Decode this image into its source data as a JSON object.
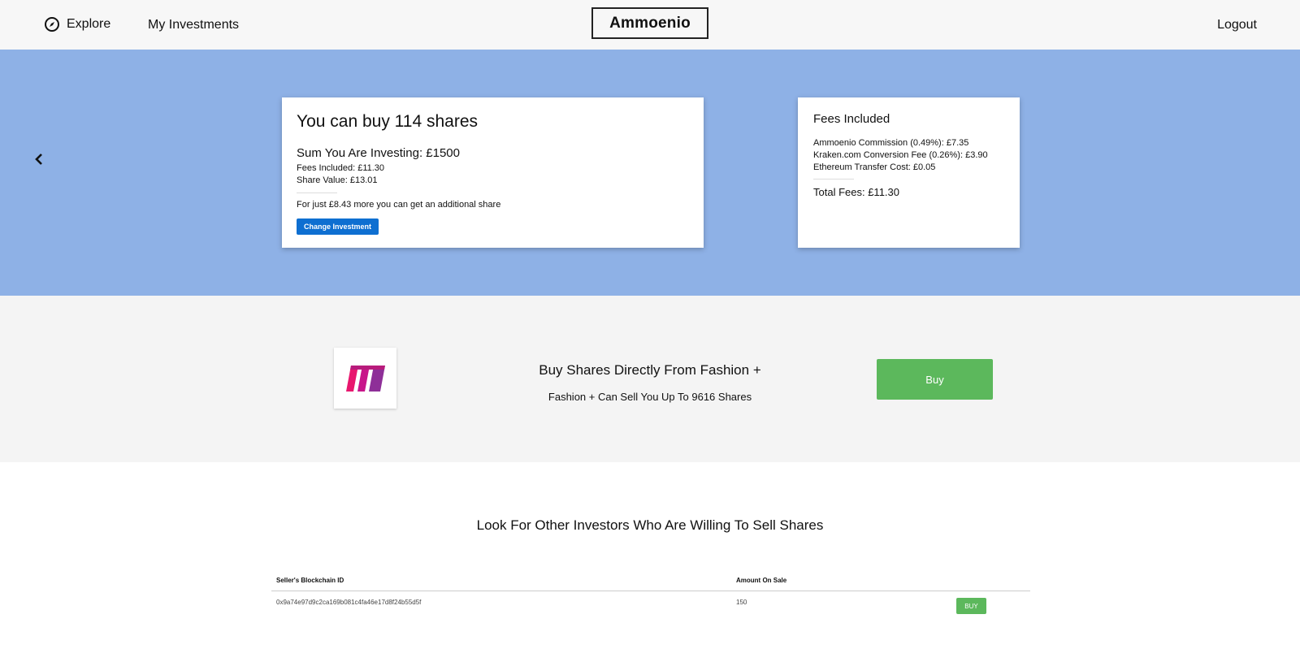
{
  "nav": {
    "explore_label": "Explore",
    "my_investments_label": "My Investments",
    "brand": "Ammoenio",
    "logout_label": "Logout"
  },
  "invest_card": {
    "headline": "You can buy 114 shares",
    "sum_investing": "Sum You Are Investing: £1500",
    "fees_included": "Fees Included: £11.30",
    "share_value": "Share Value: £13.01",
    "more_message": "For just £8.43 more you can get an additional share",
    "change_button": "Change Investment"
  },
  "fees_card": {
    "title": "Fees Included",
    "fees": [
      "Ammoenio Commission (0.49%): £7.35",
      "Kraken.com Conversion Fee (0.26%): £3.90",
      "Ethereum Transfer Cost: £0.05"
    ],
    "total": "Total Fees: £11.30"
  },
  "company": {
    "title": "Buy Shares Directly From Fashion +",
    "subtitle": "Fashion + Can Sell You Up To 9616 Shares",
    "buy_button": "Buy",
    "logo_colors": [
      "#e8176e",
      "#c8168a",
      "#8e2f98"
    ]
  },
  "sellers": {
    "title": "Look For Other Investors Who Are Willing To Sell Shares",
    "columns": [
      "Seller's Blockchain ID",
      "Amount On Sale"
    ],
    "rows": [
      {
        "id": "0x9a74e97d9c2ca169b081c4fa46e17d8f24b55d5f",
        "amount": "150",
        "button": "BUY"
      }
    ]
  },
  "colors": {
    "hero_bg": "#8eb1e6",
    "primary_button": "#0e6fd1",
    "buy_green": "#5cb85c"
  }
}
